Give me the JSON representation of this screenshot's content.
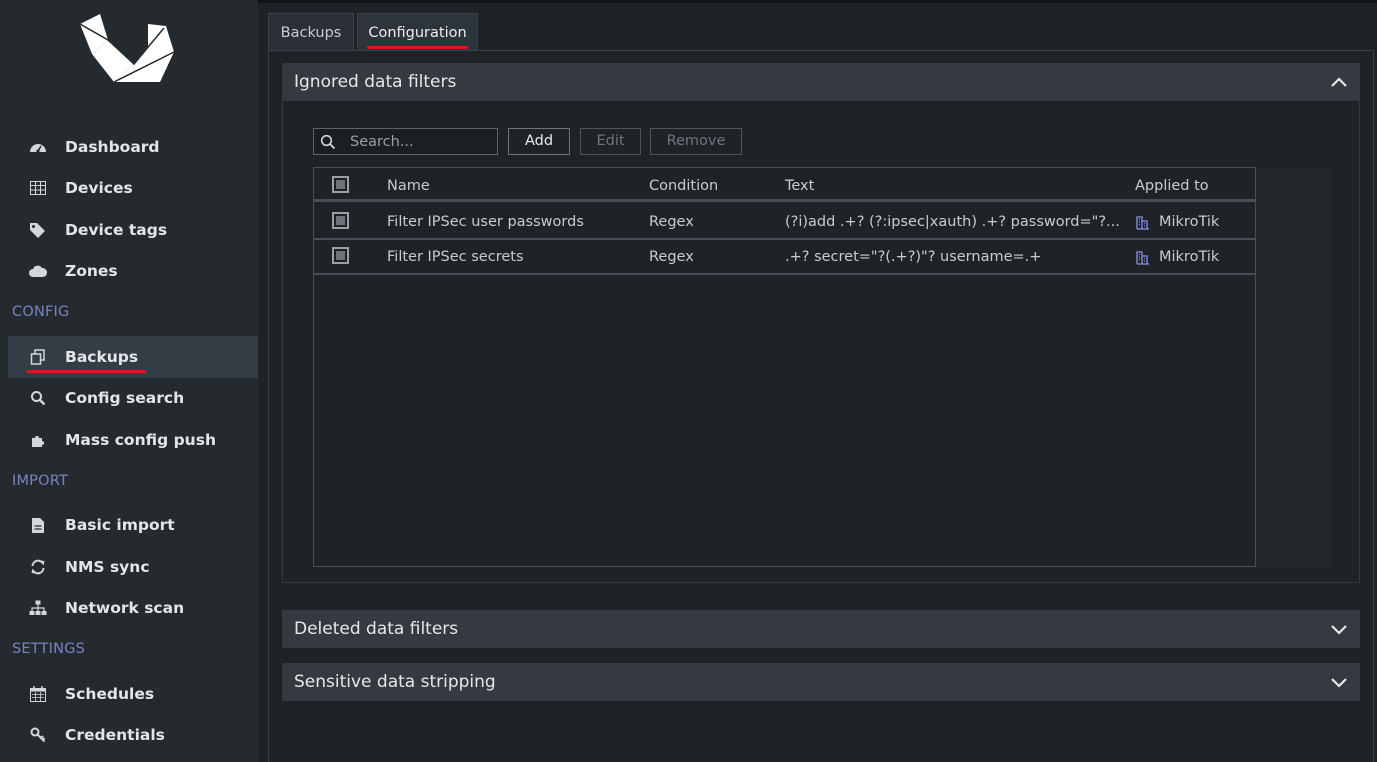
{
  "sidebar": {
    "items": [
      {
        "label": "Dashboard",
        "icon": "dashboard-icon"
      },
      {
        "label": "Devices",
        "icon": "table-icon"
      },
      {
        "label": "Device tags",
        "icon": "tags-icon"
      },
      {
        "label": "Zones",
        "icon": "cloud-icon"
      },
      {
        "label": "Backups",
        "icon": "copy-icon"
      },
      {
        "label": "Config search",
        "icon": "search-icon"
      },
      {
        "label": "Mass config push",
        "icon": "puzzle-icon"
      },
      {
        "label": "Basic import",
        "icon": "file-icon"
      },
      {
        "label": "NMS sync",
        "icon": "sync-icon"
      },
      {
        "label": "Network scan",
        "icon": "sitemap-icon"
      },
      {
        "label": "Schedules",
        "icon": "calendar-icon"
      },
      {
        "label": "Credentials",
        "icon": "key-icon"
      }
    ],
    "sections": {
      "config": "CONFIG",
      "import": "IMPORT",
      "settings": "SETTINGS"
    }
  },
  "tabs": [
    {
      "label": "Backups"
    },
    {
      "label": "Configuration"
    }
  ],
  "panels": {
    "ignored": {
      "title": "Ignored data filters"
    },
    "deleted": {
      "title": "Deleted data filters"
    },
    "sensitive": {
      "title": "Sensitive data stripping"
    }
  },
  "toolbar": {
    "search_placeholder": "Search...",
    "add_label": "Add",
    "edit_label": "Edit",
    "remove_label": "Remove"
  },
  "table": {
    "columns": [
      "Name",
      "Condition",
      "Text",
      "Applied to"
    ],
    "rows": [
      {
        "name": "Filter IPSec user passwords",
        "condition": "Regex",
        "text": "(?i)add .+? (?:ipsec|xauth) .+? password=\"?...",
        "applied": "MikroTik"
      },
      {
        "name": "Filter IPSec secrets",
        "condition": "Regex",
        "text": ".+? secret=\"?(.+?)\"? username=.+",
        "applied": "MikroTik"
      }
    ]
  },
  "colors": {
    "accent": "#e3121d",
    "section": "#7a82c4",
    "vendor_icon": "#8a93e6"
  }
}
